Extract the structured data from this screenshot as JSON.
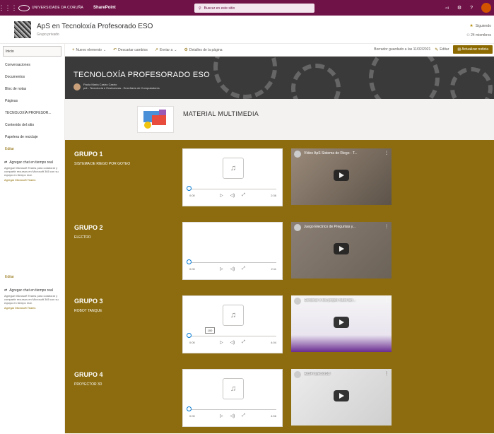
{
  "suitebar": {
    "university": "UNIVERSIDADE DA CORUÑA",
    "app": "SharePoint",
    "search_placeholder": "Buscar en este sitio"
  },
  "site": {
    "title": "ApS en Tecnoloxía Profesorado ESO",
    "subtitle": "Grupo privado",
    "following": "Siguiendo",
    "members": "24 miembros"
  },
  "nav": {
    "items": [
      "Inicio",
      "Conversaciones",
      "Documentos",
      "Bloc de notas",
      "Páginas",
      "TECNOLOXÍA PROFESOR...",
      "Contenido del sitio",
      "Papelera de reciclaje"
    ],
    "edit": "Editar",
    "chat": {
      "title": "Agregar chat en tiempo real",
      "body": "Agregue Microsoft Teams para colaborar y compartir recursos en Microsoft 365 con su equipo en tiempo real.",
      "link": "Agregar Microsoft Teams"
    }
  },
  "cmdbar": {
    "new": "Nuevo elemento",
    "discard": "Descartar cambios",
    "send": "Enviar a",
    "details": "Detalles de la página",
    "saved": "Borrador guardado a las 11/02/2021",
    "edit": "Editar",
    "publish": "Actualizar noticia"
  },
  "banner": {
    "title": "TECNOLOXÍA PROFESORADO ESO",
    "author": "Paola María Castro Castro",
    "author_sub": "pdi - Tecnoloxía e Ensinanzas - Enxeñaría de Computadores"
  },
  "multimedia": {
    "title": "MATERIAL MULTIMEDIA"
  },
  "groups": [
    {
      "title": "GRUPO 1",
      "subtitle": "SISTEMA DE RIEGO POR GOTEO",
      "time_start": "0:00",
      "duration": "2:36",
      "video_title": "Vídeo ApS Sistema de Riego - T..."
    },
    {
      "title": "GRUPO 2",
      "subtitle": "ELECTRO",
      "time_start": "0:00",
      "duration": "2:11",
      "video_title": "Juego Electrico de Preguntas y..."
    },
    {
      "title": "GRUPO 3",
      "subtitle": "ROBOT TANQUE",
      "time_start": "0:00",
      "duration": "4:04",
      "video_title": "Construe o teu propio robot tan...",
      "tooltip": "100"
    },
    {
      "title": "GRUPO 4",
      "subtitle": "PROYECTOR 3D",
      "time_start": "0:00",
      "duration": "4:56",
      "video_title": "ApSProyector3D"
    }
  ],
  "colors": {
    "suitebar": "#6f1247",
    "accent": "#8c6a00",
    "groups_bg": "#8c6c0f"
  }
}
